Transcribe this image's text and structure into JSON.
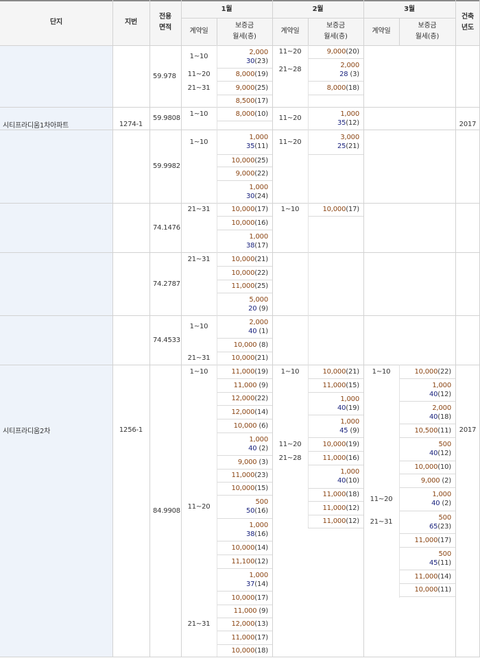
{
  "header": {
    "complex": "단지",
    "lot": "지번",
    "area": "전용\n면적",
    "month1": "1월",
    "month2": "2월",
    "month3": "3월",
    "built": "건축\n년도",
    "contract_day": "계약일",
    "deposit_rent": "보증금\n월세(층)"
  },
  "complexes": [
    {
      "name": "시티프라디움1차아파트",
      "lot": "1274-1",
      "year": "2017"
    },
    {
      "name": "시티프라디움2차",
      "lot": "1256-1",
      "year": "2017"
    }
  ],
  "areas": [
    "59.978",
    "59.9808",
    "59.9982",
    "74.1476",
    "74.2787",
    "74.4533",
    "84.9908"
  ],
  "entries": [
    {
      "id": "e1",
      "dep": "2,000",
      "rent": "30",
      "floor": "(23)"
    },
    {
      "id": "e2",
      "dep": "8,000",
      "rent": "",
      "floor": "(19)"
    },
    {
      "id": "e3",
      "dep": "9,000",
      "rent": "",
      "floor": "(25)"
    },
    {
      "id": "e4",
      "dep": "8,500",
      "rent": "",
      "floor": "(17)"
    },
    {
      "id": "e5",
      "dep": "9,000",
      "rent": "",
      "floor": "(20)"
    },
    {
      "id": "e6",
      "dep": "2,000",
      "rent": "28",
      "floor": " (3)"
    },
    {
      "id": "e7",
      "dep": "8,000",
      "rent": "",
      "floor": "(18)"
    },
    {
      "id": "e8",
      "dep": "8,000",
      "rent": "",
      "floor": "(10)"
    },
    {
      "id": "e9",
      "dep": "1,000",
      "rent": "35",
      "floor": "(12)"
    },
    {
      "id": "e10",
      "dep": "1,000",
      "rent": "35",
      "floor": "(11)"
    },
    {
      "id": "e11",
      "dep": "10,000",
      "rent": "",
      "floor": "(25)"
    },
    {
      "id": "e12",
      "dep": "9,000",
      "rent": "",
      "floor": "(22)"
    },
    {
      "id": "e13",
      "dep": "1,000",
      "rent": "30",
      "floor": "(24)"
    },
    {
      "id": "e14",
      "dep": "3,000",
      "rent": "25",
      "floor": "(21)"
    },
    {
      "id": "e15",
      "dep": "10,000",
      "rent": "",
      "floor": "(17)"
    },
    {
      "id": "e16",
      "dep": "10,000",
      "rent": "",
      "floor": "(16)"
    },
    {
      "id": "e17",
      "dep": "1,000",
      "rent": "38",
      "floor": "(17)"
    },
    {
      "id": "e18",
      "dep": "10,000",
      "rent": "",
      "floor": "(17)"
    },
    {
      "id": "e19",
      "dep": "10,000",
      "rent": "",
      "floor": "(21)"
    },
    {
      "id": "e20",
      "dep": "10,000",
      "rent": "",
      "floor": "(22)"
    },
    {
      "id": "e21",
      "dep": "11,000",
      "rent": "",
      "floor": "(25)"
    },
    {
      "id": "e22",
      "dep": "5,000",
      "rent": "20",
      "floor": " (9)"
    },
    {
      "id": "e23",
      "dep": "2,000",
      "rent": "40",
      "floor": " (1)"
    },
    {
      "id": "e24",
      "dep": "10,000",
      "rent": "",
      "floor": " (8)"
    },
    {
      "id": "e25",
      "dep": "10,000",
      "rent": "",
      "floor": "(21)"
    },
    {
      "id": "e26",
      "dep": "11,000",
      "rent": "",
      "floor": "(19)"
    },
    {
      "id": "e27",
      "dep": "11,000",
      "rent": "",
      "floor": " (9)"
    },
    {
      "id": "e28",
      "dep": "12,000",
      "rent": "",
      "floor": "(22)"
    },
    {
      "id": "e29",
      "dep": "12,000",
      "rent": "",
      "floor": "(14)"
    },
    {
      "id": "e30",
      "dep": "10,000",
      "rent": "",
      "floor": " (6)"
    },
    {
      "id": "e31",
      "dep": "1,000",
      "rent": "40",
      "floor": " (2)"
    },
    {
      "id": "e32",
      "dep": "9,000",
      "rent": "",
      "floor": " (3)"
    },
    {
      "id": "e33",
      "dep": "11,000",
      "rent": "",
      "floor": "(23)"
    },
    {
      "id": "e34",
      "dep": "10,000",
      "rent": "",
      "floor": "(15)"
    },
    {
      "id": "e35",
      "dep": "500",
      "rent": "50",
      "floor": "(16)"
    },
    {
      "id": "e36",
      "dep": "1,000",
      "rent": "38",
      "floor": "(16)"
    },
    {
      "id": "e37",
      "dep": "10,000",
      "rent": "",
      "floor": "(14)"
    },
    {
      "id": "e38",
      "dep": "11,100",
      "rent": "",
      "floor": "(12)"
    },
    {
      "id": "e39",
      "dep": "1,000",
      "rent": "37",
      "floor": "(14)"
    },
    {
      "id": "e40",
      "dep": "10,000",
      "rent": "",
      "floor": "(17)"
    },
    {
      "id": "e41",
      "dep": "11,000",
      "rent": "",
      "floor": " (9)"
    },
    {
      "id": "e42",
      "dep": "12,000",
      "rent": "",
      "floor": "(13)"
    },
    {
      "id": "e43",
      "dep": "11,000",
      "rent": "",
      "floor": "(17)"
    },
    {
      "id": "e44",
      "dep": "10,000",
      "rent": "",
      "floor": "(18)"
    },
    {
      "id": "e45",
      "dep": "10,000",
      "rent": "",
      "floor": "(21)"
    },
    {
      "id": "e46",
      "dep": "11,000",
      "rent": "",
      "floor": "(15)"
    },
    {
      "id": "e47",
      "dep": "1,000",
      "rent": "40",
      "floor": "(19)"
    },
    {
      "id": "e48",
      "dep": "1,000",
      "rent": "45",
      "floor": " (9)"
    },
    {
      "id": "e49",
      "dep": "10,000",
      "rent": "",
      "floor": "(19)"
    },
    {
      "id": "e50",
      "dep": "11,000",
      "rent": "",
      "floor": "(16)"
    },
    {
      "id": "e51",
      "dep": "1,000",
      "rent": "40",
      "floor": "(10)"
    },
    {
      "id": "e52",
      "dep": "11,000",
      "rent": "",
      "floor": "(18)"
    },
    {
      "id": "e53",
      "dep": "11,000",
      "rent": "",
      "floor": "(12)"
    },
    {
      "id": "e54",
      "dep": "11,000",
      "rent": "",
      "floor": "(12)"
    },
    {
      "id": "e55",
      "dep": "10,000",
      "rent": "",
      "floor": "(22)"
    },
    {
      "id": "e56",
      "dep": "1,000",
      "rent": "40",
      "floor": "(12)"
    },
    {
      "id": "e57",
      "dep": "2,000",
      "rent": "40",
      "floor": "(18)"
    },
    {
      "id": "e58",
      "dep": "10,500",
      "rent": "",
      "floor": "(11)"
    },
    {
      "id": "e59",
      "dep": "500",
      "rent": "40",
      "floor": "(12)"
    },
    {
      "id": "e60",
      "dep": "10,000",
      "rent": "",
      "floor": "(10)"
    },
    {
      "id": "e61",
      "dep": "9,000",
      "rent": "",
      "floor": " (2)"
    },
    {
      "id": "e62",
      "dep": "1,000",
      "rent": "40",
      "floor": " (2)"
    },
    {
      "id": "e63",
      "dep": "500",
      "rent": "65",
      "floor": "(23)"
    },
    {
      "id": "e64",
      "dep": "11,000",
      "rent": "",
      "floor": "(17)"
    },
    {
      "id": "e65",
      "dep": "500",
      "rent": "45",
      "floor": "(11)"
    },
    {
      "id": "e66",
      "dep": "11,000",
      "rent": "",
      "floor": "(14)"
    },
    {
      "id": "e67",
      "dep": "10,000",
      "rent": "",
      "floor": "(11)"
    }
  ],
  "days": {
    "d1": "1~10",
    "d2": "11~20",
    "d3": "21~31",
    "d4": "11~20",
    "d5": "21~28",
    "d6": "1~10",
    "d7": "11~20",
    "d8": "1~10",
    "d9": "11~20",
    "d10": "21~31",
    "d11": "1~10",
    "d12": "21~31",
    "d13": "1~10",
    "d14": "21~31",
    "d15": "1~10",
    "d16": "11~20",
    "d17": "21~31",
    "d18": "1~10",
    "d19": "11~20",
    "d20": "21~28",
    "d21": "1~10",
    "d22": "11~20",
    "d23": "21~31"
  }
}
